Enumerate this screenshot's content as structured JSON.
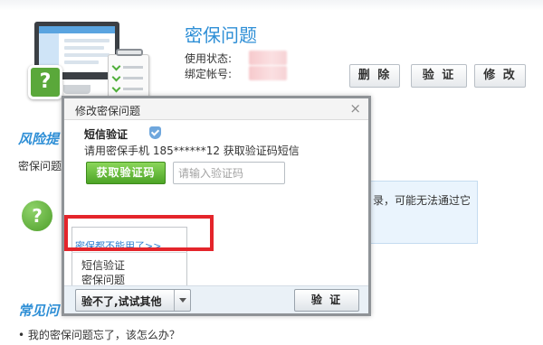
{
  "page": {
    "section_title": "密保问题",
    "status_label": "使用状态:",
    "account_label": "绑定帐号:",
    "buttons": {
      "delete": "删 除",
      "verify": "验 证",
      "edit": "修 改"
    },
    "risk_title": "风险提",
    "risk_text": "密保问题",
    "note_text": "录，可能无法通过它",
    "faq_title": "常见问",
    "faq_item": "• 我的密保问题忘了，该怎么办？"
  },
  "dialog": {
    "title": "修改密保问题",
    "close": "×",
    "sms_title": "短信验证",
    "sms_desc": "请用密保手机 185******12 获取验证码短信",
    "get_code": "获取验证码",
    "code_placeholder": "请输入验证码",
    "menu": {
      "link": "密保都不能用了>>",
      "items": [
        "短信验证",
        "密保问题"
      ]
    },
    "other_btn": "验不了,试试其他",
    "verify_btn": "验 证"
  },
  "colors": {
    "accent_blue": "#2f8fd6",
    "green": "#4da426",
    "highlight_red": "#e4252b"
  },
  "icons": [
    "question-badge-icon",
    "shield-icon",
    "close-icon",
    "caret-down-icon"
  ]
}
